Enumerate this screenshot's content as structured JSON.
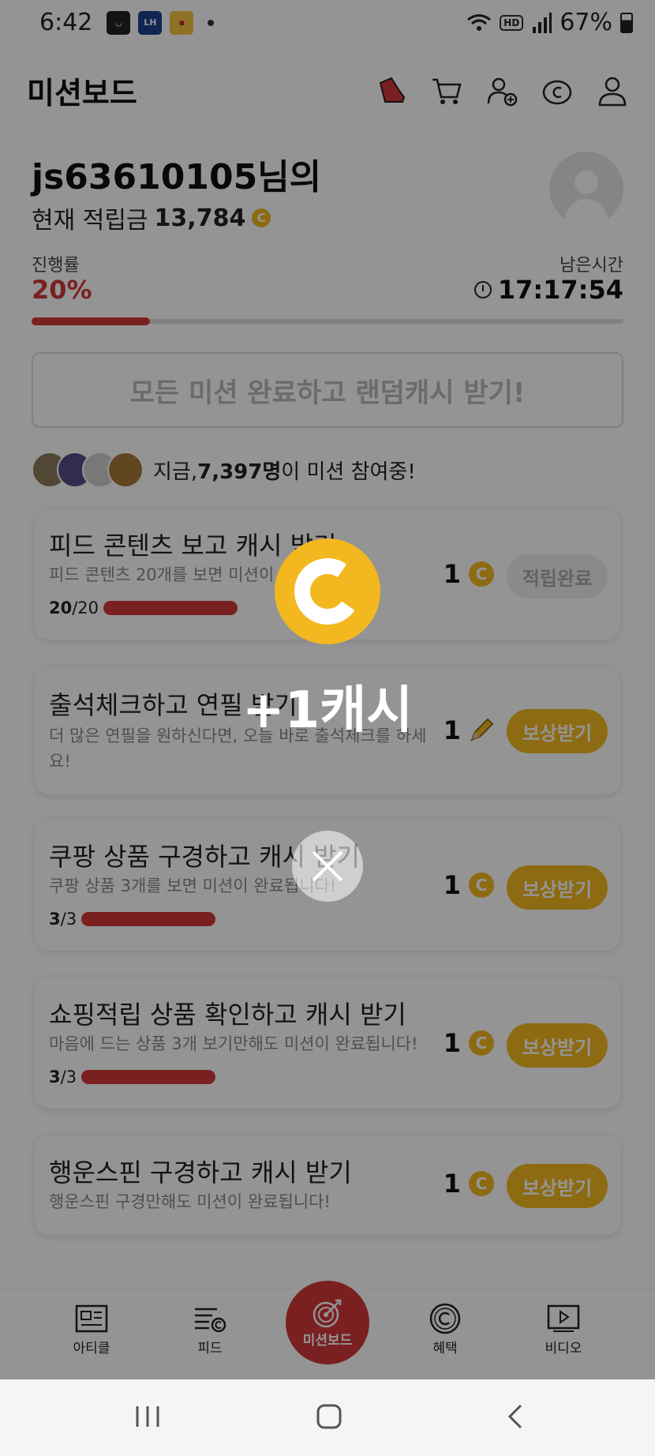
{
  "status_bar": {
    "time": "6:42",
    "battery": "67%",
    "hd_label": "HD",
    "notif_lh_label": "LH"
  },
  "header": {
    "title": "미션보드"
  },
  "user": {
    "name": "js63610105님의",
    "points_label": "현재 적립금",
    "points_value": "13,784",
    "coin_symbol": "C"
  },
  "progress": {
    "label": "진행률",
    "value": "20%",
    "fraction": 0.2,
    "time_label": "남은시간",
    "time_value": "17:17:54"
  },
  "random_cash_button": "모든 미션 완료하고 랜덤캐시 받기!",
  "participants": {
    "prefix": "지금, ",
    "count": "7,397명",
    "suffix": "이 미션 참여중!"
  },
  "missions": [
    {
      "title": "피드 콘텐츠 보고 캐시 받기",
      "desc": "피드 콘텐츠 20개를 보면 미션이 완료됩니다!",
      "count_done": "20",
      "count_total": "/20",
      "reward": "1",
      "reward_icon": "coin-icon",
      "button": "적립완료",
      "state": "done"
    },
    {
      "title": "출석체크하고 연필 받기",
      "desc": "더 많은 연필을 원하신다면, 오늘 바로 출석체크를 하세요!",
      "reward": "1",
      "reward_icon": "pencil-icon",
      "button": "보상받기",
      "state": "claim"
    },
    {
      "title": "쿠팡 상품 구경하고 캐시 받기",
      "desc": "쿠팡 상품 3개를 보면 미션이 완료됩니다!",
      "count_done": "3",
      "count_total": "/3",
      "reward": "1",
      "reward_icon": "coin-icon",
      "button": "보상받기",
      "state": "claim"
    },
    {
      "title": "쇼핑적립 상품 확인하고 캐시 받기",
      "desc": "마음에 드는 상품 3개 보기만해도 미션이 완료됩니다!",
      "count_done": "3",
      "count_total": "/3",
      "reward": "1",
      "reward_icon": "coin-icon",
      "button": "보상받기",
      "state": "claim"
    },
    {
      "title": "행운스핀 구경하고 캐시 받기",
      "desc": "행운스핀 구경만해도 미션이 완료됩니다!",
      "reward": "1",
      "reward_icon": "coin-icon",
      "button": "보상받기",
      "state": "claim"
    }
  ],
  "bottom_nav": {
    "article": "아티클",
    "feed": "피드",
    "mission": "미션보드",
    "benefit": "혜택",
    "video": "비디오"
  },
  "overlay": {
    "reward_text": "+1캐시"
  },
  "colors": {
    "accent_red": "#d2373a",
    "coin_yellow": "#f3b81f",
    "overlay": "rgba(0,0,0,0.42)"
  }
}
